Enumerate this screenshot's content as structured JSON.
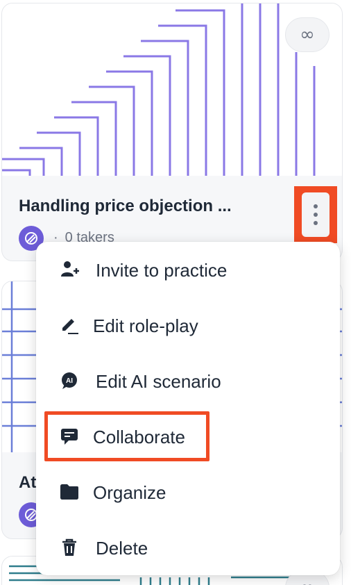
{
  "cards": [
    {
      "title": "Handling price objection ...",
      "badge": "∞",
      "meta_dot": "·",
      "takers": "0 takers",
      "accent": "#7c6be0"
    },
    {
      "title": "At",
      "accent": "#6b7fd8"
    },
    {
      "badge": "∞",
      "accent": "#2f7d8c"
    }
  ],
  "menu": {
    "items": [
      {
        "label": "Invite to practice",
        "icon": "person-add-icon"
      },
      {
        "label": "Edit role-play",
        "icon": "pencil-icon"
      },
      {
        "label": "Edit AI scenario",
        "icon": "ai-chat-icon"
      },
      {
        "label": "Collaborate",
        "icon": "comment-icon"
      },
      {
        "label": "Organize",
        "icon": "folder-icon"
      },
      {
        "label": "Delete",
        "icon": "trash-icon"
      }
    ]
  },
  "colors": {
    "highlight": "#f04b24",
    "avatar": "#6d5cd8",
    "text": "#1f2937",
    "muted": "#6b7280"
  }
}
